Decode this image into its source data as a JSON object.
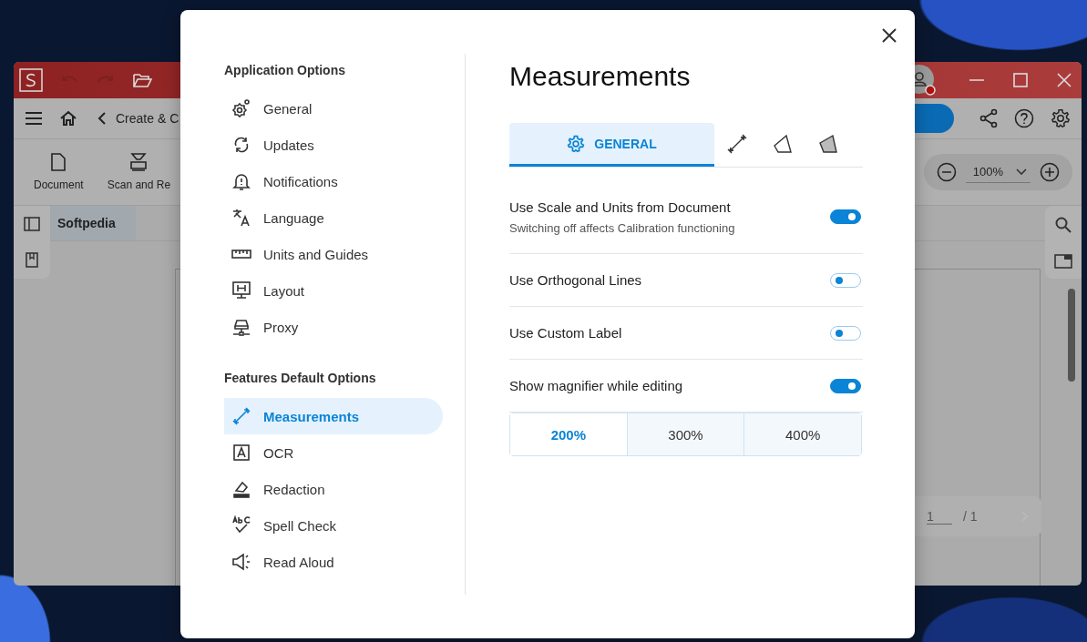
{
  "app": {
    "breadcrumb": "Create & C",
    "tools": [
      {
        "label": "Document",
        "kind": "document"
      },
      {
        "label": "Scan and Re",
        "kind": "scanner"
      }
    ],
    "zoom": "100%",
    "doc_tab": "Softpedia",
    "page_nav": {
      "current": "1",
      "total": "/ 1"
    }
  },
  "dialog": {
    "sections": [
      {
        "heading": "Application Options",
        "items": [
          {
            "label": "General",
            "kind": "gear",
            "selected": false
          },
          {
            "label": "Updates",
            "kind": "sync",
            "selected": false
          },
          {
            "label": "Notifications",
            "kind": "bell",
            "selected": false
          },
          {
            "label": "Language",
            "kind": "translate",
            "selected": false
          },
          {
            "label": "Units and Guides",
            "kind": "ruler",
            "selected": false
          },
          {
            "label": "Layout",
            "kind": "monitor",
            "selected": false
          },
          {
            "label": "Proxy",
            "kind": "proxy",
            "selected": false
          }
        ]
      },
      {
        "heading": "Features Default Options",
        "items": [
          {
            "label": "Measurements",
            "kind": "measure",
            "selected": true
          },
          {
            "label": "OCR",
            "kind": "ocr",
            "selected": false
          },
          {
            "label": "Redaction",
            "kind": "eraser",
            "selected": false
          },
          {
            "label": "Spell Check",
            "kind": "spell",
            "selected": false
          },
          {
            "label": "Read Aloud",
            "kind": "megaphone",
            "selected": false
          }
        ]
      }
    ],
    "title": "Measurements",
    "tabs": [
      {
        "kind": "label",
        "label": "GENERAL",
        "selected": true
      },
      {
        "kind": "icon",
        "selected": false
      },
      {
        "kind": "icon",
        "selected": false
      },
      {
        "kind": "icon",
        "selected": false
      }
    ],
    "settings": [
      {
        "label": "Use Scale and Units from Document",
        "hint": "Switching off affects Calibration functioning",
        "on": true
      },
      {
        "label": "Use Orthogonal Lines",
        "on": false
      },
      {
        "label": "Use Custom Label",
        "on": false
      },
      {
        "label": "Show magnifier while editing",
        "on": true
      }
    ],
    "magnifier_zoom": [
      {
        "label": "200%",
        "selected": true
      },
      {
        "label": "300%",
        "selected": false
      },
      {
        "label": "400%",
        "selected": false
      }
    ]
  }
}
